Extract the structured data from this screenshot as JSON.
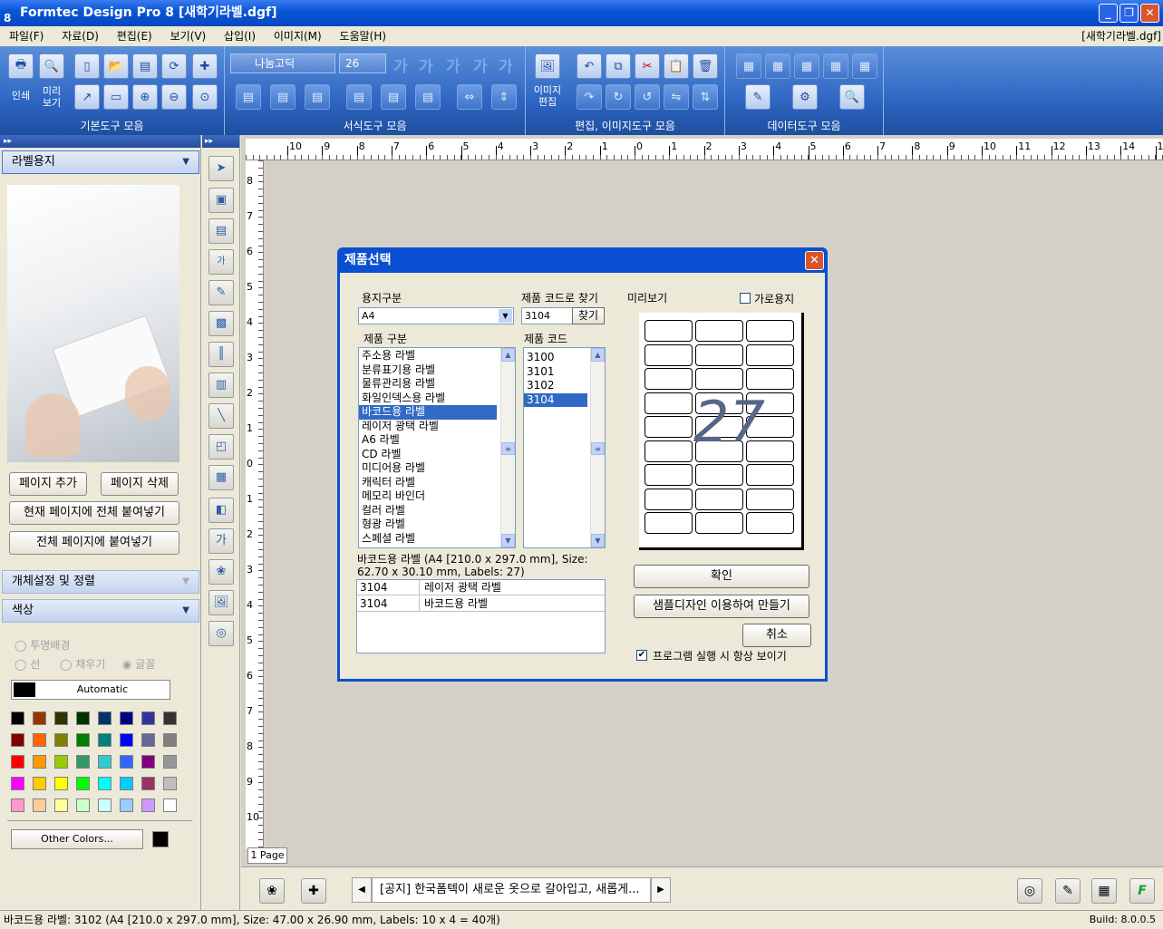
{
  "window": {
    "title": "Formtec Design Pro 8 [새학기라벨.dgf]",
    "file_label": "[새학기라벨.dgf]"
  },
  "menu": [
    "파일(F)",
    "자료(D)",
    "편집(E)",
    "보기(V)",
    "삽입(I)",
    "이미지(M)",
    "도움말(H)"
  ],
  "toolbar": {
    "groups": [
      "기본도구 모음",
      "서식도구 모음",
      "편집, 이미지도구 모음",
      "데이터도구 모음"
    ],
    "print_label": "인쇄",
    "preview_label": "미리\n보기",
    "image_edit_label": "이미지\n편집",
    "font_name": "나눔고딕",
    "font_size": "26"
  },
  "left_panel": {
    "section_label_paper": "라벨용지",
    "add_page": "페이지 추가",
    "delete_page": "페이지 삭제",
    "paste_all_current": "현재 페이지에 전체 붙여넣기",
    "paste_all_pages": "전체 페이지에 붙여넣기",
    "section_object": "개체설정 및 정렬",
    "section_color": "색상",
    "radio_transparent": "투명배경",
    "radio_line": "선",
    "radio_fill": "채우기",
    "radio_text": "글꼴",
    "automatic": "Automatic",
    "other_colors": "Other Colors..."
  },
  "colors": {
    "accent": "#0a4fd1",
    "selection": "#316ac5"
  },
  "palette": [
    [
      "#000000",
      "#993300",
      "#333300",
      "#003300",
      "#003366",
      "#000080",
      "#333399",
      "#333333"
    ],
    [
      "#800000",
      "#ff6600",
      "#808000",
      "#008000",
      "#008080",
      "#0000ff",
      "#666699",
      "#808080"
    ],
    [
      "#ff0000",
      "#ff9900",
      "#99cc00",
      "#339966",
      "#33cccc",
      "#3366ff",
      "#800080",
      "#969696"
    ],
    [
      "#ff00ff",
      "#ffcc00",
      "#ffff00",
      "#00ff00",
      "#00ffff",
      "#00ccff",
      "#993366",
      "#c0c0c0"
    ],
    [
      "#ff99cc",
      "#ffcc99",
      "#ffff99",
      "#ccffcc",
      "#ccffff",
      "#99ccff",
      "#cc99ff",
      "#ffffff"
    ]
  ],
  "canvas": {
    "page_tab": "1 Page",
    "hruler": [
      "10",
      "9",
      "8",
      "7",
      "6",
      "5",
      "4",
      "3",
      "2",
      "1",
      "0",
      "1",
      "2",
      "3",
      "4",
      "5",
      "6",
      "7",
      "8",
      "9",
      "10",
      "11",
      "12",
      "13",
      "14",
      "15"
    ],
    "vruler": [
      "8",
      "7",
      "6",
      "5",
      "4",
      "3",
      "2",
      "1",
      "0",
      "1",
      "2",
      "3",
      "4",
      "5",
      "6",
      "7",
      "8",
      "9",
      "10"
    ]
  },
  "notice": "[공지] 한국폼텍이 새로운 옷으로 갈아입고, 새롭게...",
  "status": {
    "text": "바코드용 라벨: 3102 (A4 [210.0 x 297.0 mm], Size: 47.00 x 26.90 mm,  Labels: 10 x 4 = 40개)",
    "build": "Build: 8.0.0.5"
  },
  "dialog": {
    "title": "제품선택",
    "paper_type_label": "용지구분",
    "paper_type_value": "A4",
    "code_search_label": "제품 코드로 찾기",
    "code_search_value": "3104",
    "find_button": "찾기",
    "preview_label": "미리보기",
    "landscape_label": "가로용지",
    "category_label": "제품 구분",
    "code_label": "제품 코드",
    "categories": [
      "주소용 라벨",
      "분류표기용 라벨",
      "물류관리용 라벨",
      "화일인덱스용 라벨",
      "바코드용 라벨",
      "레이저 광택 라벨",
      "A6 라벨",
      "CD 라벨",
      "미디어용 라벨",
      "캐릭터 라벨",
      "메모리 바인더",
      "컬러 라벨",
      "형광 라벨",
      "스페셜 라벨"
    ],
    "selected_category": 4,
    "codes": [
      "3100",
      "3101",
      "3102",
      "3104"
    ],
    "selected_code": 3,
    "description": "바코드용 라벨 (A4 [210.0 x 297.0 mm], Size: 62.70 x 30.10 mm, Labels: 27)",
    "results": [
      {
        "code": "3104",
        "name": "레이저 광택 라벨"
      },
      {
        "code": "3104",
        "name": "바코드용 라벨"
      }
    ],
    "label_count": "27",
    "ok_button": "확인",
    "sample_button": "샘플디자인 이용하여 만들기",
    "cancel_button": "취소",
    "show_on_start": "프로그램 실행 시 항상 보이기"
  }
}
